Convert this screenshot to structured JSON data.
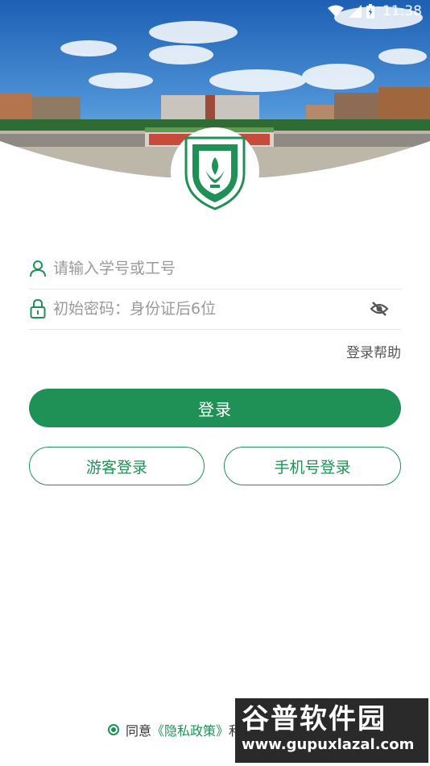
{
  "status_bar": {
    "time": "11:38",
    "icons": [
      "wifi-icon",
      "signal-icon",
      "battery-icon"
    ]
  },
  "header": {
    "photo": "campus-gate-photo",
    "logo": "college-emblem"
  },
  "form": {
    "username": {
      "placeholder": "请输入学号或工号",
      "value": "",
      "icon": "user-icon"
    },
    "password": {
      "placeholder": "初始密码：身份证后6位",
      "value": "",
      "icon": "lock-icon",
      "toggle_icon": "eye-off-icon"
    },
    "help_link": "登录帮助"
  },
  "actions": {
    "login": "登录",
    "guest_login": "游客登录",
    "phone_login": "手机号登录"
  },
  "footer": {
    "agree_prefix": "同意",
    "privacy_link": "《隐私政策》",
    "agree_suffix": "和"
  },
  "watermark": {
    "brand": "谷普软件园",
    "url": "www.gupuxlazal.com"
  },
  "colors": {
    "accent": "#1f9156",
    "placeholder": "#9a9a9a",
    "divider": "#e6e6e6"
  }
}
